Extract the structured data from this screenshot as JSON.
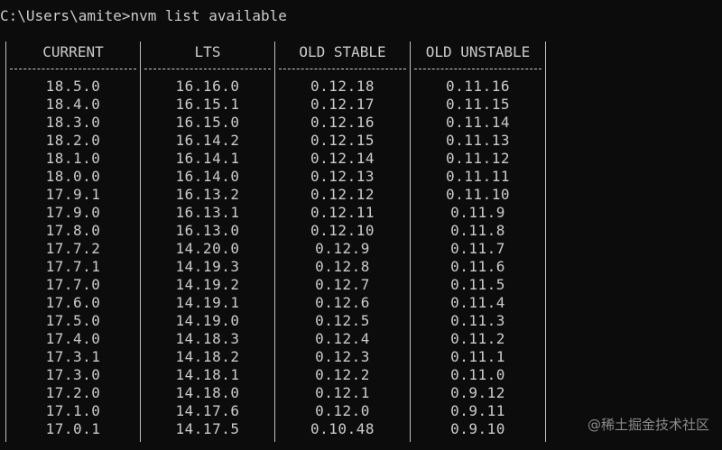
{
  "terminal": {
    "prompt": "C:\\Users\\amite>",
    "command": "nvm list available"
  },
  "table": {
    "columns": [
      {
        "header": "CURRENT",
        "values": [
          "18.5.0",
          "18.4.0",
          "18.3.0",
          "18.2.0",
          "18.1.0",
          "18.0.0",
          "17.9.1",
          "17.9.0",
          "17.8.0",
          "17.7.2",
          "17.7.1",
          "17.7.0",
          "17.6.0",
          "17.5.0",
          "17.4.0",
          "17.3.1",
          "17.3.0",
          "17.2.0",
          "17.1.0",
          "17.0.1"
        ]
      },
      {
        "header": "LTS",
        "values": [
          "16.16.0",
          "16.15.1",
          "16.15.0",
          "16.14.2",
          "16.14.1",
          "16.14.0",
          "16.13.2",
          "16.13.1",
          "16.13.0",
          "14.20.0",
          "14.19.3",
          "14.19.2",
          "14.19.1",
          "14.19.0",
          "14.18.3",
          "14.18.2",
          "14.18.1",
          "14.18.0",
          "14.17.6",
          "14.17.5"
        ]
      },
      {
        "header": "OLD STABLE",
        "values": [
          "0.12.18",
          "0.12.17",
          "0.12.16",
          "0.12.15",
          "0.12.14",
          "0.12.13",
          "0.12.12",
          "0.12.11",
          "0.12.10",
          "0.12.9",
          "0.12.8",
          "0.12.7",
          "0.12.6",
          "0.12.5",
          "0.12.4",
          "0.12.3",
          "0.12.2",
          "0.12.1",
          "0.12.0",
          "0.10.48"
        ]
      },
      {
        "header": "OLD UNSTABLE",
        "values": [
          "0.11.16",
          "0.11.15",
          "0.11.14",
          "0.11.13",
          "0.11.12",
          "0.11.11",
          "0.11.10",
          "0.11.9",
          "0.11.8",
          "0.11.7",
          "0.11.6",
          "0.11.5",
          "0.11.4",
          "0.11.3",
          "0.11.2",
          "0.11.1",
          "0.11.0",
          "0.9.12",
          "0.9.11",
          "0.9.10"
        ]
      }
    ]
  },
  "watermark": "@稀土掘金技术社区"
}
